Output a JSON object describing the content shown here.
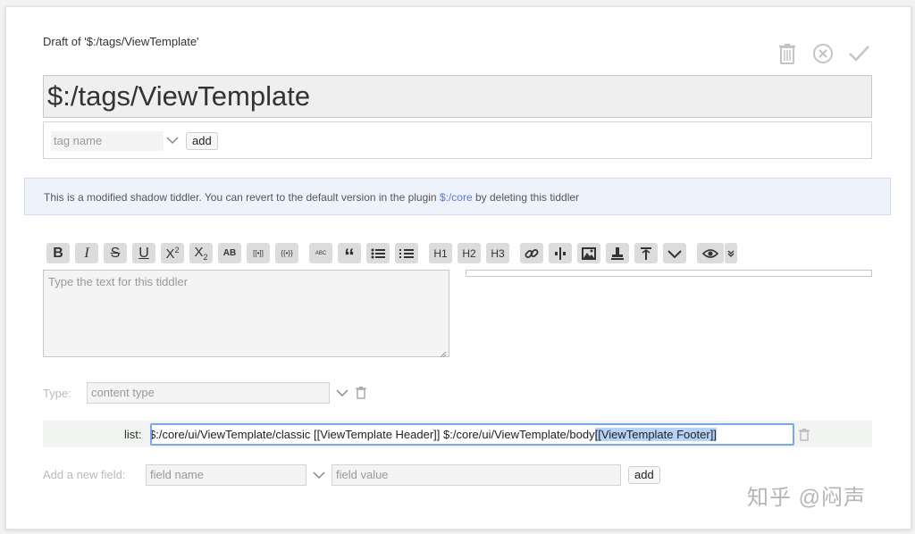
{
  "header": {
    "draft_title": "Draft of '$:/tags/ViewTemplate'",
    "title_value": "$:/tags/ViewTemplate",
    "actions": [
      "trash-icon",
      "cancel-icon",
      "done-icon"
    ]
  },
  "tags": {
    "placeholder": "tag name",
    "add_label": "add"
  },
  "notice": {
    "text_before": "This is a modified shadow tiddler. You can revert to the default version in the plugin ",
    "plugin": "$:/core",
    "text_after": " by deleting this tiddler"
  },
  "toolbar": {
    "buttons": [
      {
        "icon": "bold-icon",
        "label": "B"
      },
      {
        "icon": "italic-icon",
        "label": "I"
      },
      {
        "icon": "strikethrough-icon",
        "label": "S"
      },
      {
        "icon": "underline-icon",
        "label": "U"
      },
      {
        "icon": "superscript-icon",
        "label": "X2"
      },
      {
        "icon": "subscript-icon",
        "label": "X2"
      },
      {
        "icon": "smallcaps-icon",
        "label": "AB"
      },
      {
        "icon": "transclude-icon",
        "label": "[[•]]"
      },
      {
        "icon": "macro-icon",
        "label": "{{•}}"
      },
      {
        "icon": "monospaced-icon",
        "label": "ABC"
      },
      {
        "icon": "quote-icon",
        "label": "“"
      },
      {
        "icon": "bullet-list-icon",
        "label": ""
      },
      {
        "icon": "numbered-list-icon",
        "label": ""
      },
      {
        "icon": "heading-1-icon",
        "label": "H1"
      },
      {
        "icon": "heading-2-icon",
        "label": "H2"
      },
      {
        "icon": "heading-3-icon",
        "label": "H3"
      },
      {
        "icon": "link-icon",
        "label": ""
      },
      {
        "icon": "linkify-icon",
        "label": ""
      },
      {
        "icon": "image-icon",
        "label": ""
      },
      {
        "icon": "stamp-icon",
        "label": ""
      },
      {
        "icon": "size-icon",
        "label": ""
      },
      {
        "icon": "more-icon",
        "label": ""
      },
      {
        "icon": "preview-icon",
        "label": ""
      },
      {
        "icon": "preview-type-icon",
        "label": ""
      }
    ]
  },
  "editor": {
    "placeholder": "Type the text for this tiddler"
  },
  "type_field": {
    "label": "Type:",
    "placeholder": "content type"
  },
  "fields": {
    "list_label": "list:",
    "list_value_prefix": "$:/core/ui/ViewTemplate/classic [[ViewTemplate Header]] $:/core/ui/ViewTemplate/body ",
    "list_value_selected": "[[ViewTemplate Footer]]"
  },
  "new_field": {
    "label": "Add a new field:",
    "name_placeholder": "field name",
    "value_placeholder": "field value",
    "add_label": "add"
  },
  "watermark": "知乎 @闷声",
  "colors": {
    "notice_bg": "#eef3fb",
    "plugin_link": "#5778d8",
    "list_focus_border": "#7aa7e8",
    "selection": "#b6d3f7"
  }
}
